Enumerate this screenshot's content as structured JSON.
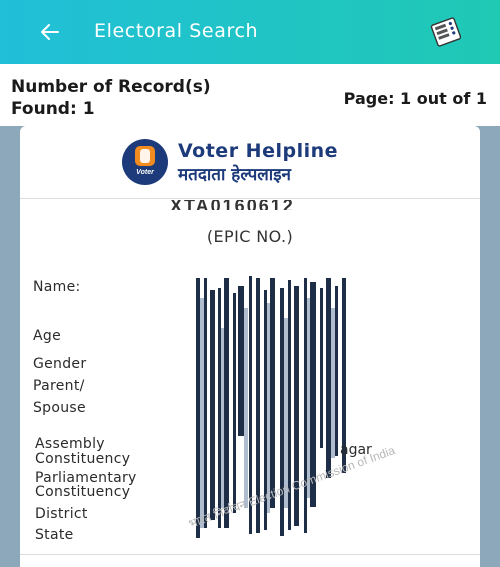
{
  "appbar": {
    "back_icon": "arrow-left-icon",
    "title": "Electoral Search",
    "action_icon": "voting-machine-icon"
  },
  "summary": {
    "records_found": "Number of Record(s) Found: 1",
    "page_info": "Page: 1 out of 1"
  },
  "card": {
    "logo_badge": "Voter",
    "logo_title": "Voter Helpline",
    "logo_subtitle": "मतदाता हेल्पलाइन",
    "epic_number": "XTA0160612",
    "epic_label": "(EPIC NO.)",
    "fields": {
      "name": "Name:",
      "age": "Age",
      "gender": "Gender",
      "parent_spouse_1": "Parent/",
      "parent_spouse_2": "Spouse",
      "assembly_1": "Assembly",
      "assembly_2": "Constituency",
      "parliamentary_1": "Parliamentary",
      "parliamentary_2": "Constituency",
      "district": "District",
      "state": "State"
    },
    "partial_value": "agar",
    "watermark": "भारत निर्वाचन Election Commission of India"
  },
  "colors": {
    "appbar_start": "#21bfd8",
    "appbar_end": "#1fc9b4",
    "background": "#8ea8bb",
    "brand_navy": "#1d3b7a",
    "brand_orange": "#f28c20"
  }
}
